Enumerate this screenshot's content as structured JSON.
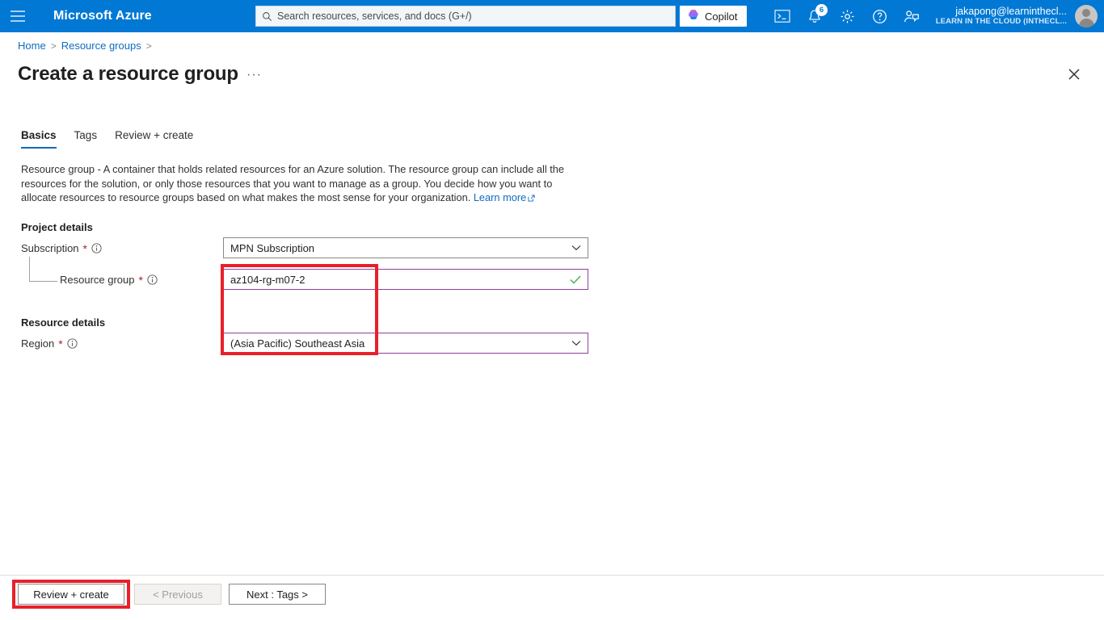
{
  "header": {
    "brand": "Microsoft Azure",
    "menu_icon": "hamburger-icon",
    "search": {
      "placeholder": "Search resources, services, and docs (G+/)",
      "value": ""
    },
    "copilot_label": "Copilot",
    "icons": [
      {
        "name": "cloud-shell-icon",
        "glyph": ">_"
      },
      {
        "name": "notifications-icon",
        "badge": "6"
      },
      {
        "name": "settings-gear-icon"
      },
      {
        "name": "help-question-icon"
      },
      {
        "name": "feedback-person-icon"
      }
    ],
    "account": {
      "email": "jakapong@learninthecl...",
      "tenant": "LEARN IN THE CLOUD (INTHECL..."
    }
  },
  "breadcrumb": {
    "items": [
      "Home",
      "Resource groups"
    ],
    "separator": ">"
  },
  "page": {
    "title": "Create a resource group",
    "ellipsis": "···",
    "close_label": "✕"
  },
  "tabs": [
    {
      "label": "Basics",
      "active": true
    },
    {
      "label": "Tags",
      "active": false
    },
    {
      "label": "Review + create",
      "active": false
    }
  ],
  "description": {
    "lead": "Resource group",
    "body": " - A container that holds related resources for an Azure solution. The resource group can include all the resources for the solution, or only those resources that you want to manage as a group. You decide how you want to allocate resources to resource groups based on what makes the most sense for your organization. ",
    "link": "Learn more"
  },
  "form": {
    "project_details_heading": "Project details",
    "resource_details_heading": "Resource details",
    "subscription": {
      "label": "Subscription",
      "required": "*",
      "value": "MPN Subscription"
    },
    "resource_group": {
      "label": "Resource group",
      "required": "*",
      "value": "az104-rg-m07-2",
      "validation": "valid"
    },
    "region": {
      "label": "Region",
      "required": "*",
      "value": "(Asia Pacific) Southeast Asia"
    }
  },
  "footer": {
    "review_create": "Review + create",
    "previous": "< Previous",
    "next": "Next : Tags >"
  },
  "annotations": {
    "field_highlight": {
      "color": "#e8202a"
    },
    "button_highlight": {
      "color": "#e8202a"
    }
  },
  "colors": {
    "azure_blue": "#0078d4",
    "link_blue": "#0f6cbd",
    "field_purple": "#8f3f9c",
    "valid_green": "#4caf50",
    "annotation_red": "#e8202a"
  }
}
